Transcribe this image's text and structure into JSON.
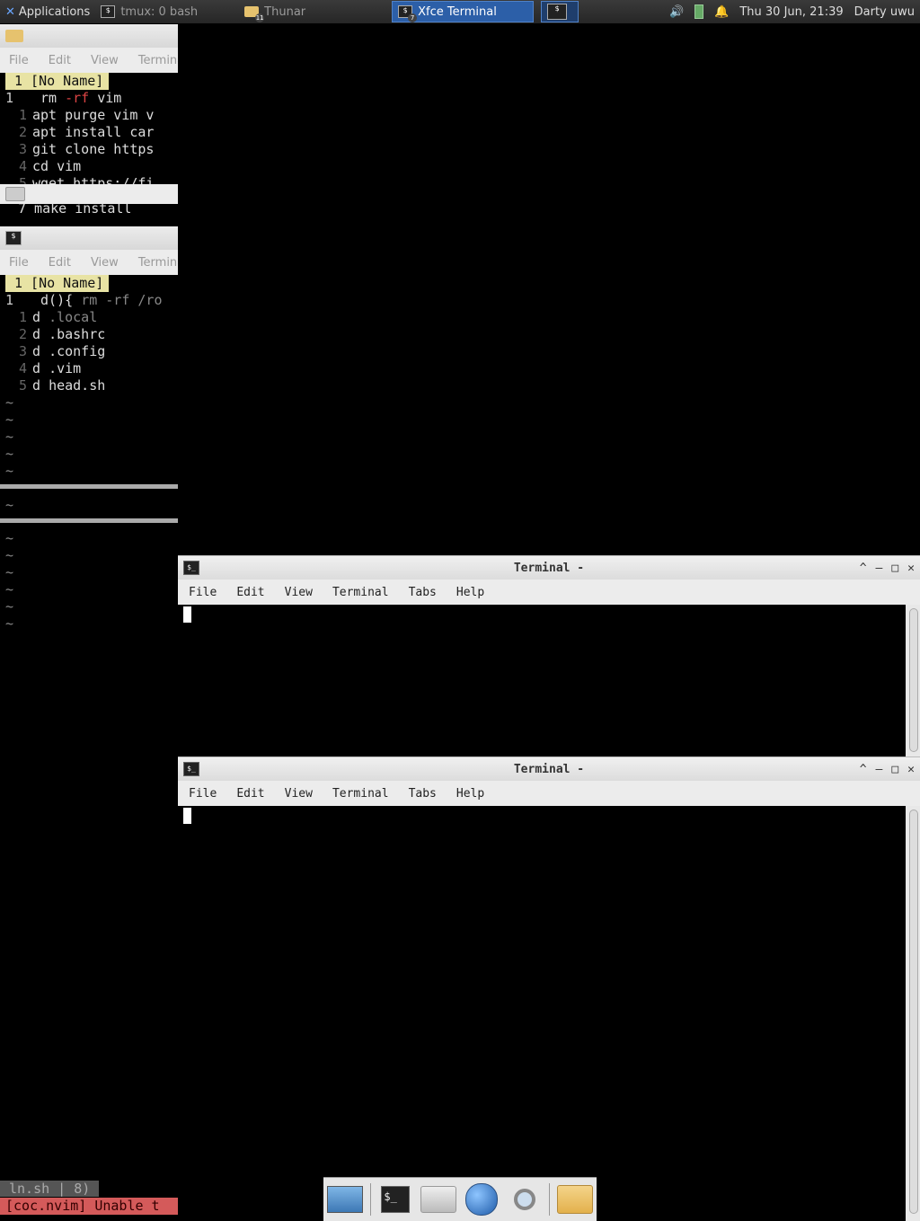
{
  "panel": {
    "applications": "Applications",
    "tasks": [
      {
        "label": "tmux: 0 bash",
        "state": "inactive"
      },
      {
        "label": "Thunar",
        "badge": "11",
        "state": "inactive"
      },
      {
        "label": "Xfce Terminal",
        "badge": "7",
        "state": "active"
      }
    ],
    "clock": "Thu 30 Jun, 21:39",
    "user": "Darty uwu",
    "colors": {
      "active": "#2c5fa8",
      "panel": "#2e2e2e"
    }
  },
  "left_top": {
    "menu": [
      "File",
      "Edit",
      "View",
      "Termina"
    ],
    "tabline": "1 [No Name]",
    "lines": [
      {
        "num": "1",
        "pre": " rm ",
        "flag": "-rf",
        "post": " vim"
      },
      {
        "num": "1",
        "text": "apt purge vim v"
      },
      {
        "num": "2",
        "text": "apt install car"
      },
      {
        "num": "3",
        "text": "git clone https"
      },
      {
        "num": "4",
        "text": "cd vim"
      },
      {
        "num": "5",
        "text": "wget https://fi"
      }
    ],
    "partial": "7  make install"
  },
  "left_bottom": {
    "menu": [
      "File",
      "Edit",
      "View",
      "Termina"
    ],
    "tabline": "1 [No Name]",
    "first": {
      "num": "1",
      "pre": " d(){ ",
      "flag": "rm -rf",
      "post": " /ro"
    },
    "lines": [
      {
        "num": "1",
        "pre": "d ",
        "rest": ".local"
      },
      {
        "num": "2",
        "pre": "d ",
        "rest": ".bashrc"
      },
      {
        "num": "3",
        "pre": "d ",
        "rest": ".config"
      },
      {
        "num": "4",
        "pre": "d ",
        "rest": ".vim"
      },
      {
        "num": "5",
        "pre": "d ",
        "rest": "head.sh"
      }
    ],
    "tilde": "~",
    "status": "ln.sh | 8)",
    "error": "[coc.nvim] Unable t"
  },
  "terminal_top": {
    "title": "Terminal -",
    "menu": [
      "File",
      "Edit",
      "View",
      "Terminal",
      "Tabs",
      "Help"
    ]
  },
  "terminal_bottom": {
    "title": "Terminal -",
    "menu": [
      "File",
      "Edit",
      "View",
      "Terminal",
      "Tabs",
      "Help"
    ]
  },
  "window_controls": {
    "shade": "^",
    "minimize": "–",
    "maximize": "□",
    "close": "✕"
  },
  "dock": [
    {
      "icon": "desktop-icon"
    },
    {
      "icon": "terminal-icon"
    },
    {
      "icon": "home-folder-icon"
    },
    {
      "icon": "web-browser-icon"
    },
    {
      "icon": "search-icon"
    },
    {
      "icon": "folder-icon"
    }
  ]
}
